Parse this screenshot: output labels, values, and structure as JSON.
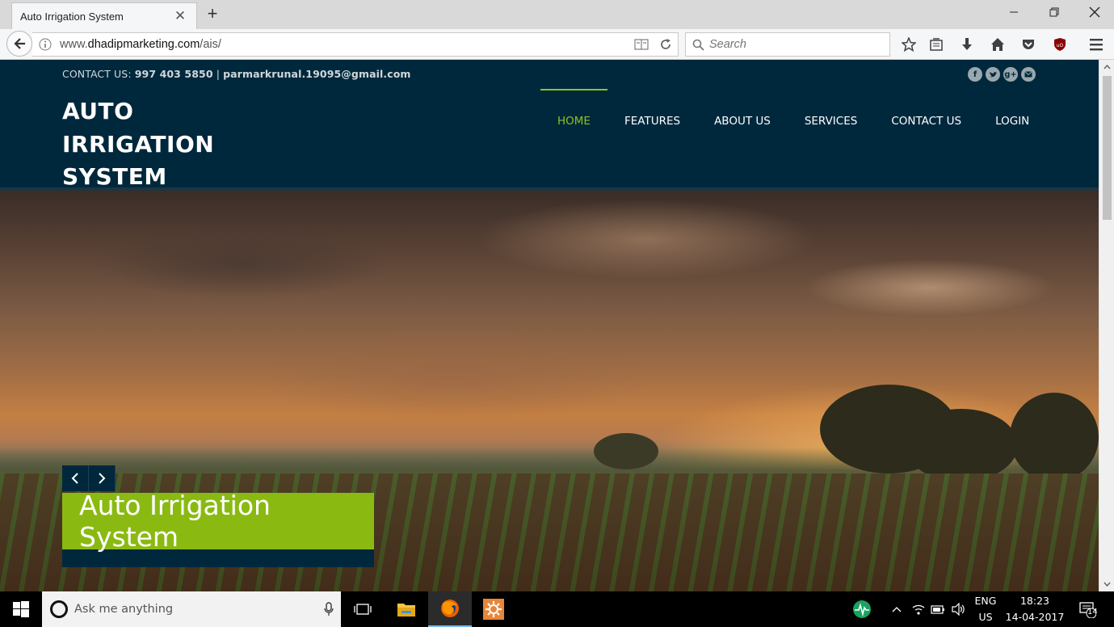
{
  "browser": {
    "tab_title": "Auto Irrigation System",
    "tab_close": "✕",
    "new_tab": "+",
    "url_prefix": "www.",
    "url_domain": "dhadipmarketing.com",
    "url_path": "/ais/",
    "search_placeholder": "Search"
  },
  "site": {
    "contact_label": "CONTACT US:",
    "phone": "997 403 5850",
    "separator": "|",
    "email": "parmarkrunal.19095@gmail.com",
    "brand_lines": [
      "AUTO",
      "IRRIGATION",
      "SYSTEM"
    ],
    "nav": [
      {
        "label": "HOME",
        "active": true
      },
      {
        "label": "FEATURES",
        "active": false
      },
      {
        "label": "ABOUT US",
        "active": false
      },
      {
        "label": "SERVICES",
        "active": false
      },
      {
        "label": "CONTACT US",
        "active": false
      },
      {
        "label": "LOGIN",
        "active": false
      }
    ],
    "socials": [
      "facebook-icon",
      "twitter-icon",
      "google-plus-icon",
      "email-icon"
    ],
    "slider_caption": "Auto Irrigation System"
  },
  "taskbar": {
    "search_placeholder": "Ask me anything",
    "lang_1": "ENG",
    "lang_2": "US",
    "time": "18:23",
    "date": "14-04-2017",
    "notification_count": "14"
  },
  "colors": {
    "header_bg": "#00283c",
    "accent_green": "#8aba12",
    "active_nav": "#8dc21f"
  }
}
